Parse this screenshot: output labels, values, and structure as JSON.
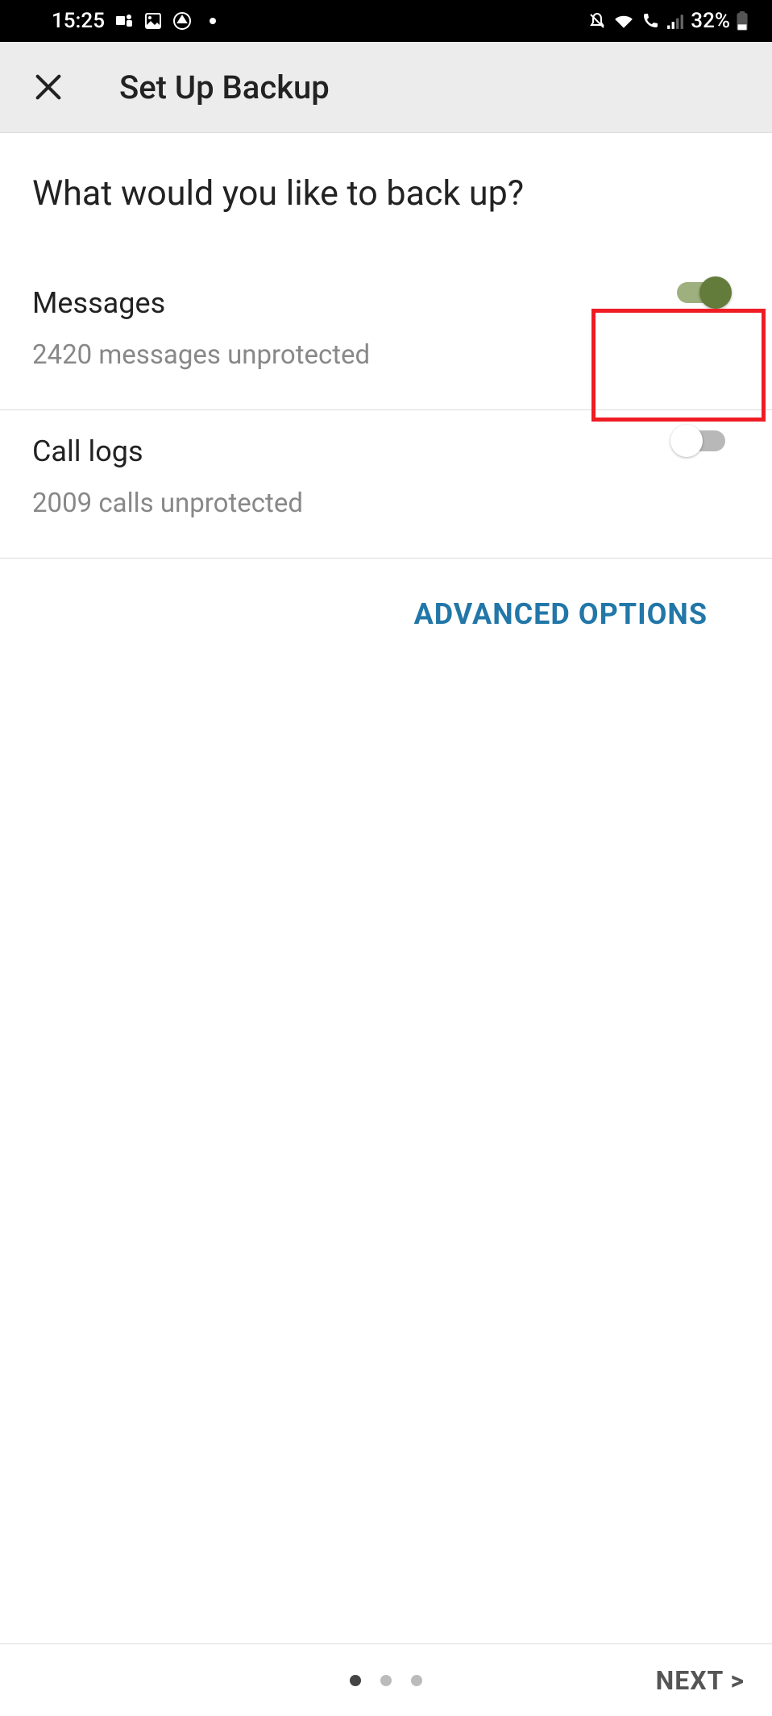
{
  "status_bar": {
    "time": "15:25",
    "battery_pct": "32%"
  },
  "app_bar": {
    "title": "Set Up Backup"
  },
  "page": {
    "question": "What would you like to back up?"
  },
  "options": {
    "messages": {
      "title": "Messages",
      "subtitle": "2420 messages unprotected",
      "enabled": true
    },
    "call_logs": {
      "title": "Call logs",
      "subtitle": "2009 calls unprotected",
      "enabled": false
    }
  },
  "advanced_label": "ADVANCED OPTIONS",
  "footer": {
    "next_label": "NEXT  >",
    "page_current": 1,
    "page_total": 3
  },
  "highlight": {
    "target": "messages-toggle"
  }
}
